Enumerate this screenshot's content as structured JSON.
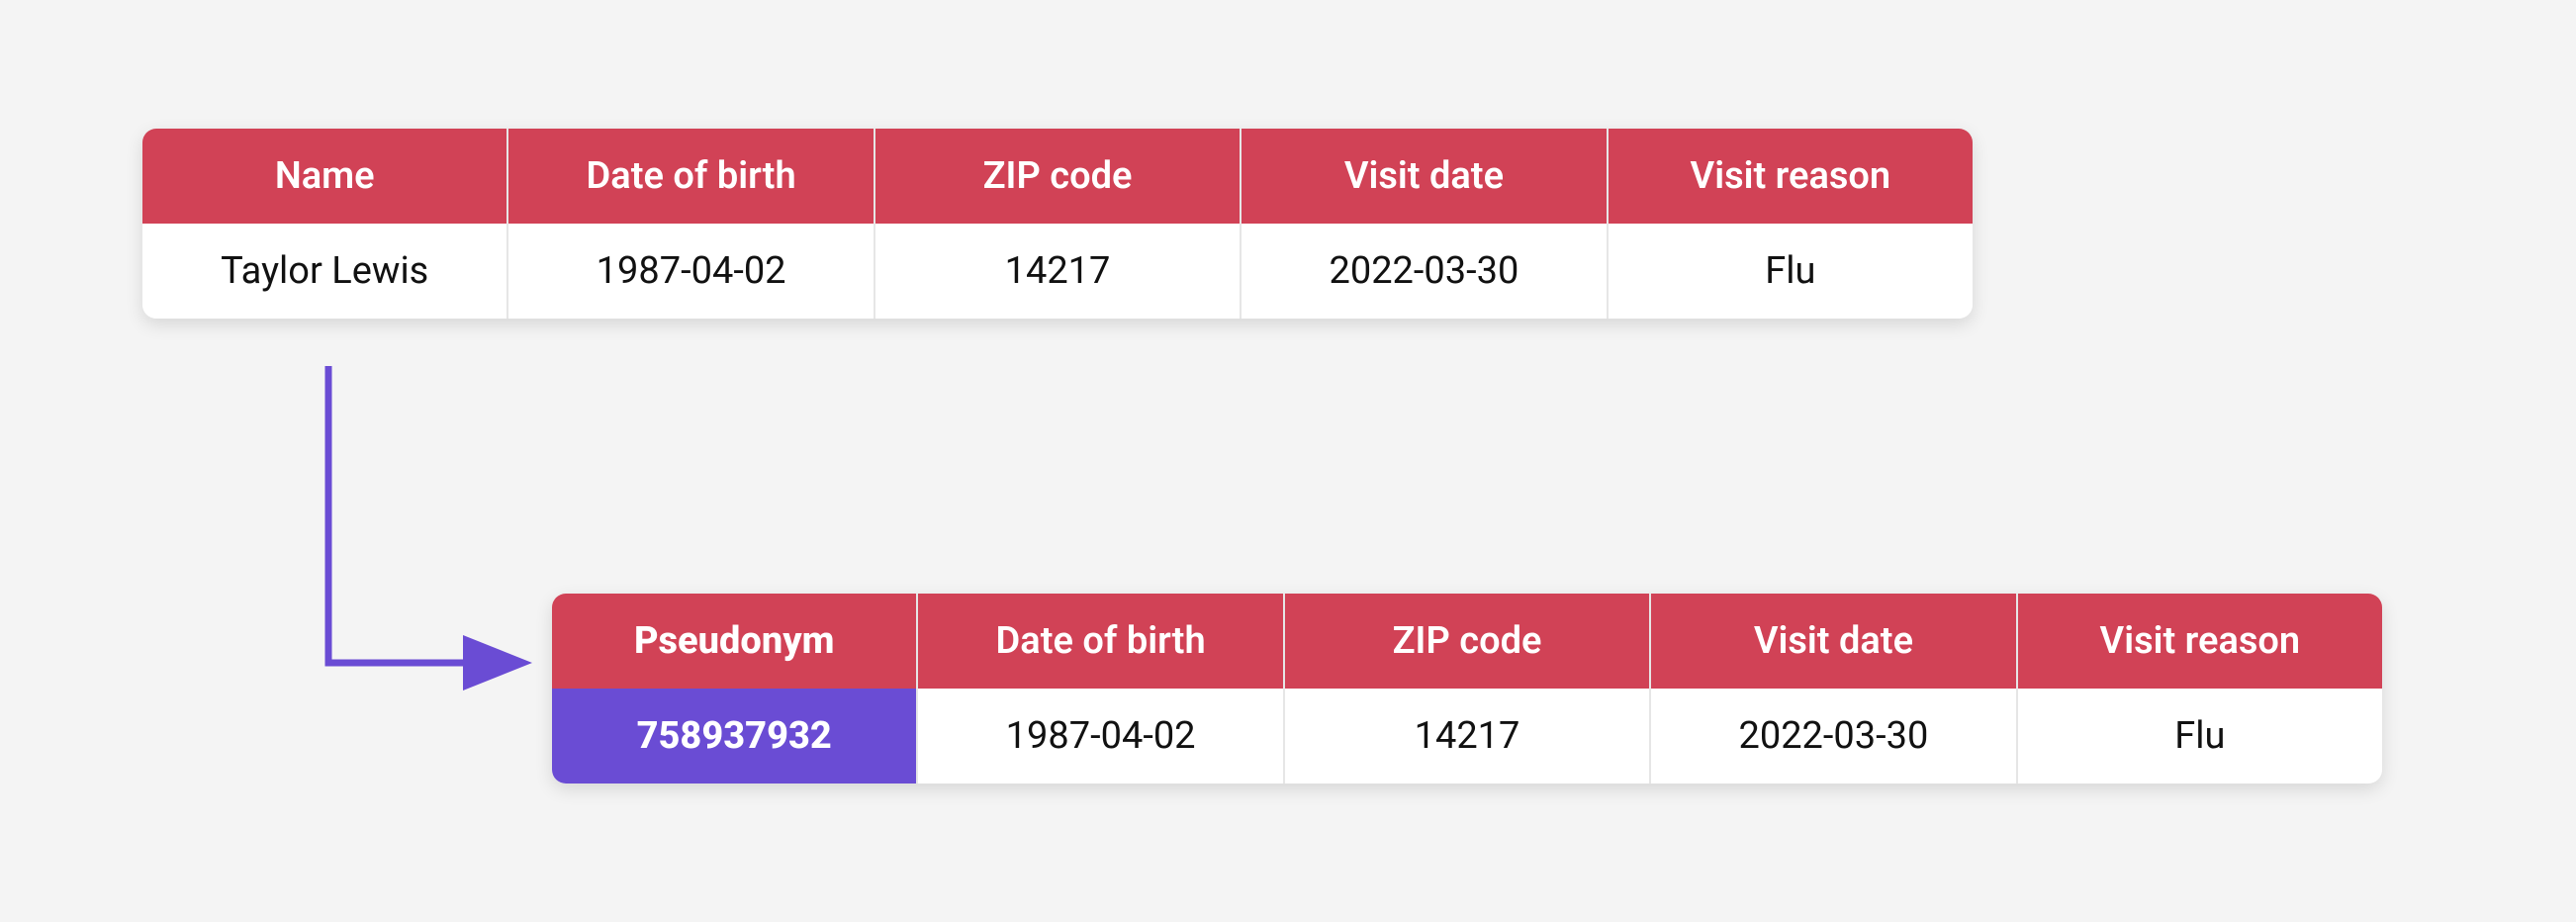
{
  "colors": {
    "header_bg": "#d14256",
    "highlight_bg": "#6a4cd4",
    "arrow": "#6a4cd4"
  },
  "top": {
    "headers": [
      "Name",
      "Date of birth",
      "ZIP code",
      "Visit date",
      "Visit reason"
    ],
    "row": [
      "Taylor Lewis",
      "1987-04-02",
      "14217",
      "2022-03-30",
      "Flu"
    ]
  },
  "bottom": {
    "headers": [
      "Pseudonym",
      "Date of birth",
      "ZIP code",
      "Visit date",
      "Visit reason"
    ],
    "row": [
      "758937932",
      "1987-04-02",
      "14217",
      "2022-03-30",
      "Flu"
    ]
  }
}
